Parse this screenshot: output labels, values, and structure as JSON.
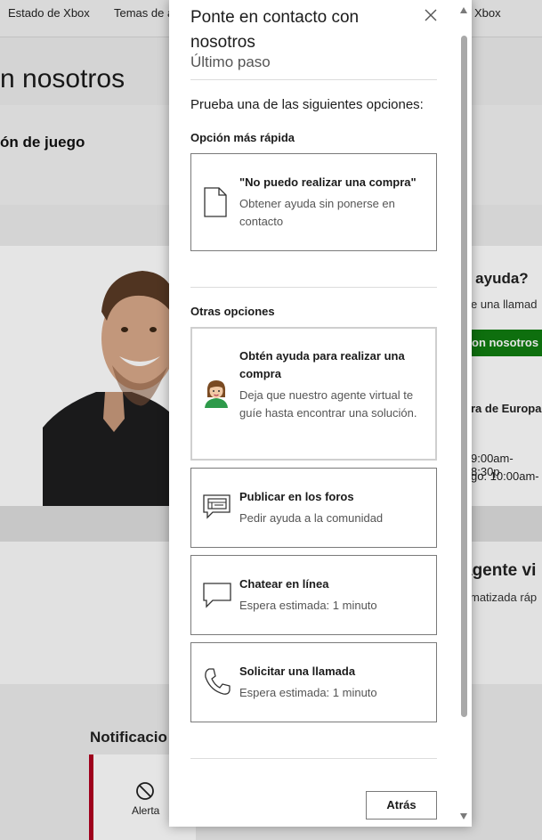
{
  "background": {
    "nav": [
      "Estado de Xbox",
      "Temas de a",
      "Xbox"
    ],
    "page_title": "n nosotros",
    "section_label": "ón de juego",
    "right_title": "s ayuda?",
    "right_text": "e una llamad",
    "green_button": "on nosotros",
    "right_sub": "ra de Europa",
    "hours_1": "9:00am-8:30p",
    "hours_2": "go: 10:00am-",
    "agent_title": "agente vi",
    "agent_text": "matizada ráp",
    "notifications_label": "Notificacio",
    "alert_label": "Alerta",
    "accent_green": "#107c10",
    "alert_red": "#b00020"
  },
  "modal": {
    "title": "Ponte en contacto con nosotros",
    "subtitle": "Último paso",
    "intro": "Prueba una de las siguientes opciones:",
    "fastest_label": "Opción más rápida",
    "fastest": {
      "title": "\"No puedo realizar una compra\"",
      "desc": "Obtener ayuda sin ponerse en contacto",
      "icon": "document-icon"
    },
    "other_label": "Otras opciones",
    "options": [
      {
        "title": "Obtén ayuda para realizar una compra",
        "desc": "Deja que nuestro agente virtual te guíe hasta encontrar una solución.",
        "icon": "virtual-agent-avatar"
      },
      {
        "title": "Publicar en los foros",
        "desc": "Pedir ayuda a la comunidad",
        "icon": "forum-icon"
      },
      {
        "title": "Chatear en línea",
        "desc": "Espera estimada: 1 minuto",
        "icon": "chat-icon"
      },
      {
        "title": "Solicitar una llamada",
        "desc": "Espera estimada: 1 minuto",
        "icon": "phone-icon"
      }
    ],
    "back_button": "Atrás"
  }
}
